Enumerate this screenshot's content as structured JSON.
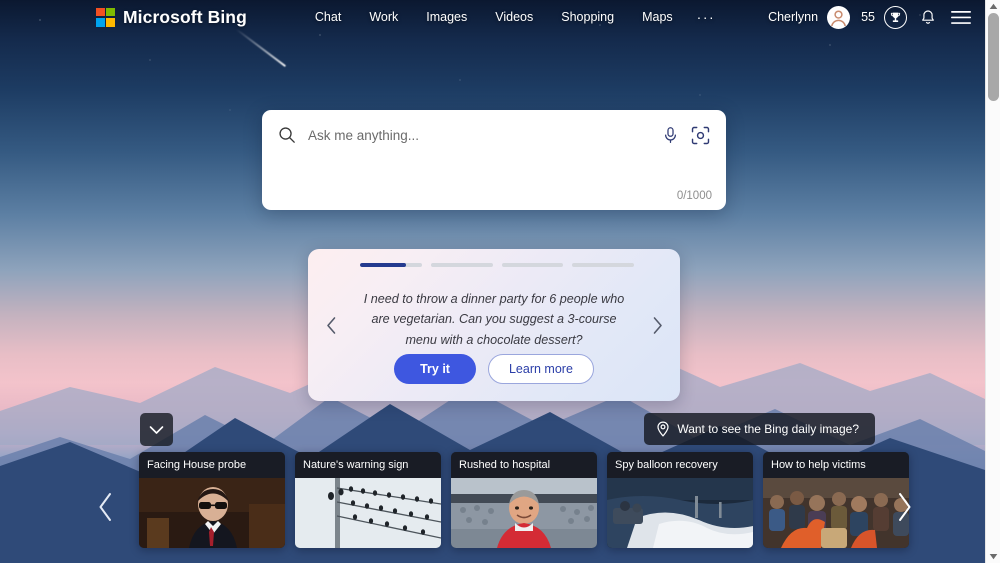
{
  "header": {
    "brand_name": "Microsoft Bing",
    "logo_colors": [
      "#f25022",
      "#7fba00",
      "#00a4ef",
      "#ffb900"
    ],
    "nav_items": [
      {
        "label": "Chat",
        "name": "nav-chat"
      },
      {
        "label": "Work",
        "name": "nav-work"
      },
      {
        "label": "Images",
        "name": "nav-images"
      },
      {
        "label": "Videos",
        "name": "nav-videos"
      },
      {
        "label": "Shopping",
        "name": "nav-shopping"
      },
      {
        "label": "Maps",
        "name": "nav-maps"
      }
    ],
    "more_label": "···",
    "user_name": "Cherlynn",
    "points_count": "55",
    "icons": {
      "avatar": "person-avatar-icon",
      "rewards": "trophy-icon",
      "notifications": "bell-icon",
      "menu": "hamburger-menu-icon"
    }
  },
  "search": {
    "placeholder": "Ask me anything...",
    "value": "",
    "char_counter": "0/1000",
    "icons": {
      "search": "search-icon",
      "mic": "microphone-icon",
      "lens": "visual-search-camera-icon"
    }
  },
  "suggestion": {
    "text": "I need to throw a dinner party for 6 people who are vegetarian. Can you suggest a 3-course menu with a chocolate dessert?",
    "try_label": "Try it",
    "learn_label": "Learn more",
    "progress": [
      75,
      0,
      0,
      0
    ],
    "prev_icon": "chevron-left-icon",
    "next_icon": "chevron-right-icon",
    "accent_color": "#3e57e0"
  },
  "daily_image": {
    "label": "Want to see the Bing daily image?",
    "icon": "location-pin-icon"
  },
  "collapse": {
    "icon": "chevron-down-icon"
  },
  "news": {
    "cards": [
      {
        "title": "Facing House probe"
      },
      {
        "title": "Nature's warning sign"
      },
      {
        "title": "Rushed to hospital"
      },
      {
        "title": "Spy balloon recovery"
      },
      {
        "title": "How to help victims"
      }
    ],
    "prev_icon": "chevron-left-icon",
    "next_icon": "chevron-right-icon"
  },
  "scrollbar": {
    "up_icon": "scroll-up-arrow-icon",
    "down_icon": "scroll-down-arrow-icon"
  }
}
